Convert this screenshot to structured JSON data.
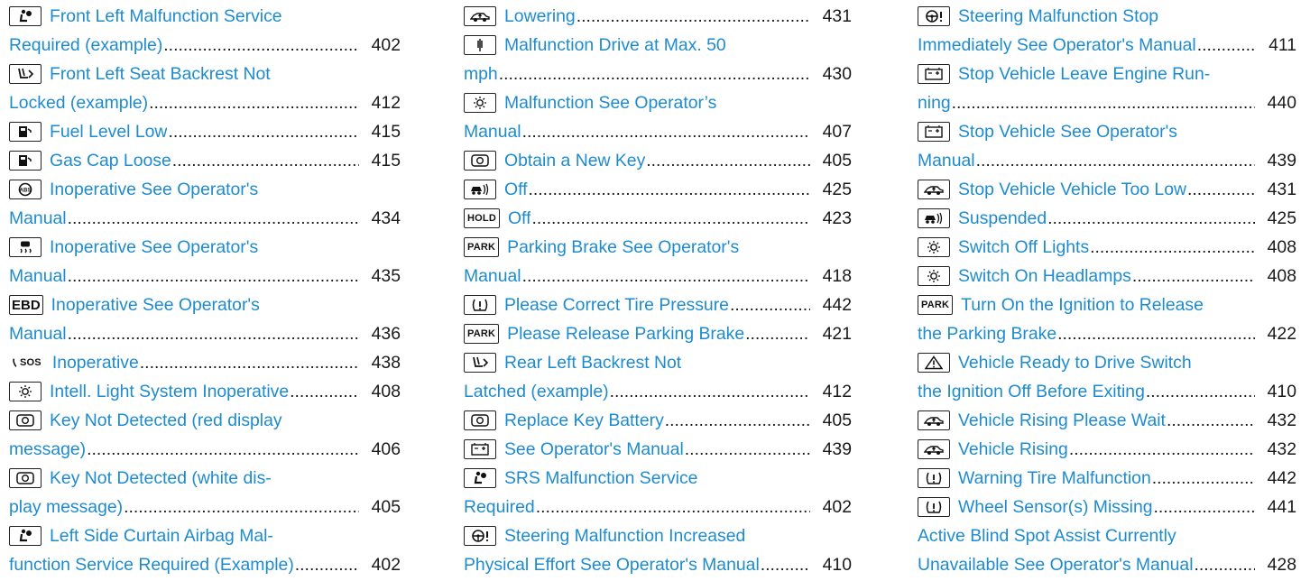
{
  "columns": [
    [
      {
        "icon": "airbag-icon",
        "lines": [
          "Front Left Malfunction Service",
          "Required (example)"
        ],
        "page": "402"
      },
      {
        "icon": "seat-backrest-icon",
        "lines": [
          "Front Left Seat Backrest Not",
          "Locked (example)"
        ],
        "page": "412"
      },
      {
        "icon": "fuel-pump-icon",
        "lines": [
          "Fuel Level Low"
        ],
        "page": "415"
      },
      {
        "icon": "fuel-pump-icon",
        "lines": [
          "Gas Cap Loose"
        ],
        "page": "415"
      },
      {
        "icon": "abs-icon",
        "lines": [
          "Inoperative See Operator's",
          "Manual"
        ],
        "page": "434"
      },
      {
        "icon": "skid-car-icon",
        "lines": [
          "Inoperative See Operator's",
          "Manual"
        ],
        "page": "435"
      },
      {
        "icon": "ebd-icon",
        "icon_text": "EBD",
        "lines": [
          "Inoperative See Operator's",
          "Manual"
        ],
        "page": "436"
      },
      {
        "icon": "sos-icon",
        "icon_text": "SOS",
        "lines": [
          "Inoperative"
        ],
        "page": "438"
      },
      {
        "icon": "light-icon",
        "lines": [
          "Intell. Light System Inoperative"
        ],
        "page": "408"
      },
      {
        "icon": "key-icon",
        "lines": [
          "Key Not Detected (red display",
          "message)"
        ],
        "page": "406"
      },
      {
        "icon": "key-icon",
        "lines": [
          "Key Not Detected (white dis-",
          "play message)"
        ],
        "page": "405"
      },
      {
        "icon": "airbag-icon",
        "lines": [
          "Left Side Curtain Airbag Mal-",
          "function Service Required (Example)"
        ],
        "page": "402"
      }
    ],
    [
      {
        "icon": "vehicle-level-icon",
        "lines": [
          "Lowering"
        ],
        "page": "431"
      },
      {
        "icon": "suspension-icon",
        "lines": [
          "Malfunction Drive at Max. 50",
          "mph"
        ],
        "page": "430"
      },
      {
        "icon": "light-icon",
        "lines": [
          "Malfunction See Operator’s",
          "Manual"
        ],
        "page": "407"
      },
      {
        "icon": "key-icon",
        "lines": [
          "Obtain a New Key"
        ],
        "page": "405"
      },
      {
        "icon": "distance-assist-icon",
        "lines": [
          "Off"
        ],
        "page": "425"
      },
      {
        "icon": "hold-icon",
        "icon_text": "HOLD",
        "lines": [
          "Off"
        ],
        "page": "423"
      },
      {
        "icon": "park-icon",
        "icon_text": "PARK",
        "lines": [
          "Parking Brake See Operator's",
          "Manual"
        ],
        "page": "418"
      },
      {
        "icon": "tire-pressure-icon",
        "lines": [
          "Please Correct Tire Pressure"
        ],
        "page": "442"
      },
      {
        "icon": "park-icon",
        "icon_text": "PARK",
        "lines": [
          "Please Release Parking Brake"
        ],
        "page": "421"
      },
      {
        "icon": "seat-backrest-icon",
        "lines": [
          "Rear Left Backrest Not",
          "Latched (example)"
        ],
        "page": "412"
      },
      {
        "icon": "key-icon",
        "lines": [
          "Replace Key Battery"
        ],
        "page": "405"
      },
      {
        "icon": "battery-icon",
        "lines": [
          "See Operator's Manual"
        ],
        "page": "439"
      },
      {
        "icon": "airbag-icon",
        "lines": [
          "SRS Malfunction Service",
          "Required"
        ],
        "page": "402"
      },
      {
        "icon": "steering-icon",
        "lines": [
          "Steering Malfunction Increased",
          "Physical Effort See Operator's Manual"
        ],
        "page": "410"
      }
    ],
    [
      {
        "icon": "steering-icon",
        "lines": [
          "Steering Malfunction Stop",
          "Immediately See Operator's Manual"
        ],
        "page": "411"
      },
      {
        "icon": "battery-icon",
        "lines": [
          "Stop Vehicle Leave Engine Run-",
          "ning"
        ],
        "page": "440"
      },
      {
        "icon": "battery-icon",
        "lines": [
          "Stop Vehicle See Operator's",
          "Manual"
        ],
        "page": "439"
      },
      {
        "icon": "vehicle-level-icon",
        "lines": [
          "Stop Vehicle Vehicle Too Low"
        ],
        "page": "431"
      },
      {
        "icon": "distance-assist-icon",
        "lines": [
          "Suspended"
        ],
        "page": "425"
      },
      {
        "icon": "light-icon",
        "lines": [
          "Switch Off Lights"
        ],
        "page": "408"
      },
      {
        "icon": "light-icon",
        "lines": [
          "Switch On Headlamps"
        ],
        "page": "408"
      },
      {
        "icon": "park-icon",
        "icon_text": "PARK",
        "lines": [
          "Turn On the Ignition to Release",
          "the Parking Brake"
        ],
        "page": "422"
      },
      {
        "icon": "warning-triangle-icon",
        "lines": [
          "Vehicle Ready to Drive Switch",
          "the Ignition Off Before Exiting"
        ],
        "page": "410"
      },
      {
        "icon": "vehicle-level-icon",
        "lines": [
          "Vehicle Rising Please Wait"
        ],
        "page": "432"
      },
      {
        "icon": "vehicle-level-icon",
        "lines": [
          "Vehicle Rising"
        ],
        "page": "432"
      },
      {
        "icon": "tire-pressure-icon",
        "lines": [
          "Warning Tire Malfunction"
        ],
        "page": "442"
      },
      {
        "icon": "tire-pressure-icon",
        "lines": [
          "Wheel Sensor(s) Missing"
        ],
        "page": "441"
      },
      {
        "icon": null,
        "lines": [
          "Active Blind Spot Assist Currently",
          "Unavailable See Operator's Manual"
        ],
        "page": "428"
      }
    ]
  ],
  "colors": {
    "link": "#1e8bcf",
    "text": "#1a1a1a",
    "icon_border": "#222222"
  }
}
